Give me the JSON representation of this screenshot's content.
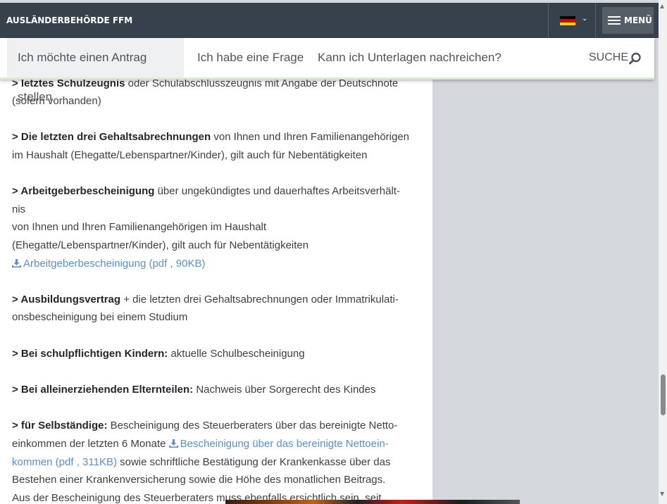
{
  "header": {
    "brand": "AUSLÄNDERBEHÖRDE FFM",
    "language": {
      "flag_colors": [
        "#000000",
        "#dd0000",
        "#ffce00"
      ]
    },
    "menu_label": "MENÜ"
  },
  "subnav": {
    "tabs": [
      {
        "label": "Ich möchte einen Antrag stellen",
        "active": true
      },
      {
        "label": "Ich habe eine Frage",
        "active": false
      },
      {
        "label": "Kann ich Unterlagen nachreichen?",
        "active": false
      }
    ],
    "search_label": "SUCHE"
  },
  "content": {
    "lines": [
      {
        "bold": "> letztes Schulzeugnis",
        "text": " oder Schulabschlusszeugnis mit Angabe der Deutschnote"
      },
      {
        "text": "(sofern vorhanden)"
      },
      {
        "bold": "> Die letzten drei Gehaltsabrechnungen",
        "text": " von Ihnen und Ihren Familienangehörigen"
      },
      {
        "text": "im Haushalt (Ehegatte/Lebenspartner/Kinder), gilt auch für Nebentätigkeiten"
      },
      {
        "bold": "> Arbeitgeberbescheinigung",
        "text": " über ungekündigtes und dauerhaftes Arbeitsverhält-"
      },
      {
        "text": "nis"
      },
      {
        "text": "von Ihnen und Ihren Familienangehörigen im Haushalt"
      },
      {
        "text": "(Ehegatte/Lebenspartner/Kinder), gilt auch für Nebentätigkeiten"
      },
      {
        "link": "Arbeitgeberbescheinigung (pdf , 90KB)"
      },
      {
        "bold": "> Ausbildungsvertrag",
        "text": " + die letzten drei Gehaltsabrechnungen oder Immatrikulati-"
      },
      {
        "text": "onsbescheinigung bei einem Studium"
      },
      {
        "bold": "> Bei schulpflichtigen Kindern:",
        "text": " aktuelle Schulbescheinigung"
      },
      {
        "bold": "> Bei alleinerziehenden Elternteilen:",
        "text": " Nachweis über Sorgerecht des Kindes"
      },
      {
        "bold": "> für Selbständige:",
        "text": " Bescheinigung des Steuerberaters über das bereinigte Netto-"
      },
      {
        "text": "einkommen der letzten 6 Monate ",
        "link": "Bescheinigung über das bereinigte Nettoein-"
      },
      {
        "link": "kommen (pdf , 311KB)",
        "text": " sowie schriftliche Bestätigung der Krankenkasse über das"
      },
      {
        "text": "Bestehen einer Krankenversicherung sowie die Höhe des monatlichen Beitrags."
      },
      {
        "text": "Aus der Bescheinigung des Steuerberaters muss ebenfalls ersichtlich sein, seit"
      }
    ]
  },
  "colors": {
    "header_bg": "#37414b",
    "link": "#5b8fd1",
    "sidebar_bg": "#d4d7db"
  }
}
